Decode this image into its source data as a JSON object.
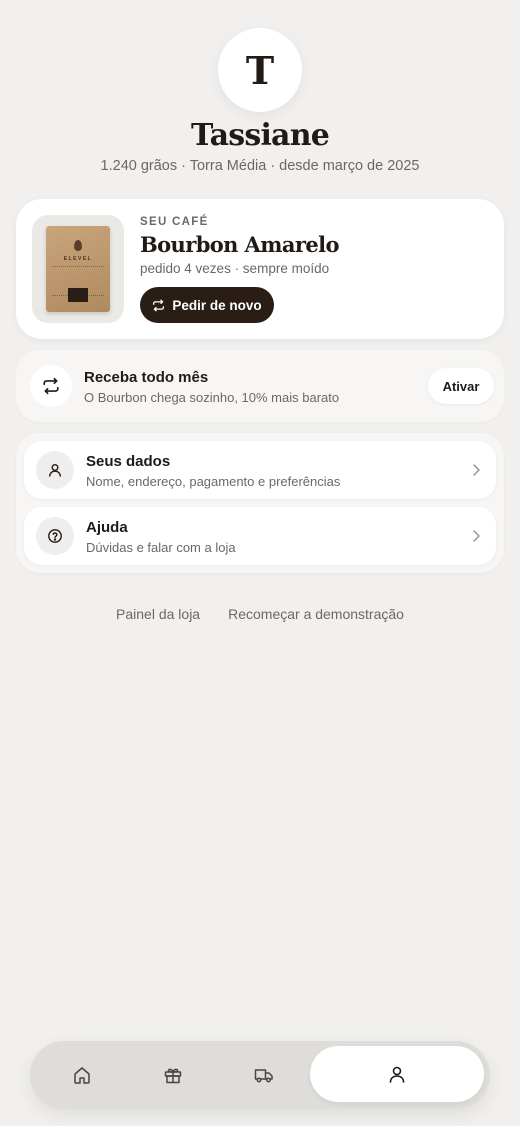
{
  "profile": {
    "initial": "T",
    "name": "Tassiane",
    "meta": "1.240 grãos · Torra Média · desde março de 2025"
  },
  "coffee": {
    "eyebrow": "SEU CAFÉ",
    "name": "Bourbon Amarelo",
    "meta": "pedido 4 vezes · sempre moído",
    "reorder_label": "Pedir de novo",
    "bag_brand": "ELEVEL"
  },
  "subscription": {
    "title": "Receba todo mês",
    "description": "O Bourbon chega sozinho, 10% mais barato",
    "activate_label": "Ativar"
  },
  "menu": [
    {
      "title": "Seus dados",
      "description": "Nome, endereço, pagamento e preferências",
      "icon": "user-icon"
    },
    {
      "title": "Ajuda",
      "description": "Dúvidas e falar com a loja",
      "icon": "help-icon"
    }
  ],
  "footer": {
    "store_panel": "Painel da loja",
    "restart_demo": "Recomeçar a demonstração"
  },
  "tabbar": {
    "tabs": [
      {
        "icon": "home-icon",
        "active": false
      },
      {
        "icon": "gift-icon",
        "active": false
      },
      {
        "icon": "delivery-truck-icon",
        "active": false
      },
      {
        "icon": "user-icon",
        "active": true
      }
    ]
  },
  "colors": {
    "background": "#f1f0ee",
    "primary_dark": "#2a1d16",
    "text_muted": "#6e6762",
    "card": "#ffffff"
  }
}
